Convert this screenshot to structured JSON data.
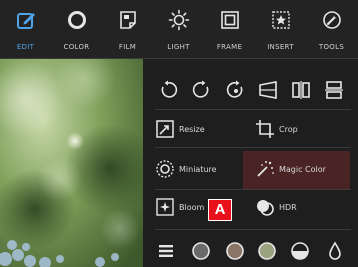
{
  "toolbar": {
    "items": [
      {
        "label": "EDIT",
        "icon": "edit-icon",
        "active": true
      },
      {
        "label": "COLOR",
        "icon": "color-ring-icon",
        "active": false
      },
      {
        "label": "FILM",
        "icon": "film-icon",
        "active": false
      },
      {
        "label": "LIGHT",
        "icon": "light-sun-icon",
        "active": false
      },
      {
        "label": "FRAME",
        "icon": "frame-icon",
        "active": false
      },
      {
        "label": "INSERT",
        "icon": "insert-star-icon",
        "active": false
      },
      {
        "label": "TOOLS",
        "icon": "tools-icon",
        "active": false
      }
    ]
  },
  "panel": {
    "transform_icons": [
      "rotate-left-icon",
      "rotate-right-icon",
      "rotate-free-icon",
      "perspective-icon",
      "flip-horizontal-icon",
      "flip-vertical-icon"
    ],
    "options": {
      "resize": "Resize",
      "crop": "Crop",
      "miniature": "Miniature",
      "magic_color": "Magic Color",
      "bloom": "Bloom",
      "hdr": "HDR"
    },
    "bottom_icons": [
      "list-menu-icon",
      "preset-dark-icon",
      "preset-warm-icon",
      "preset-green-icon",
      "preset-half-icon",
      "drop-icon"
    ]
  },
  "marker": {
    "label": "A"
  },
  "colors": {
    "accent": "#4fa3e8",
    "highlight": "#4a2424",
    "marker": "#e8101a"
  }
}
